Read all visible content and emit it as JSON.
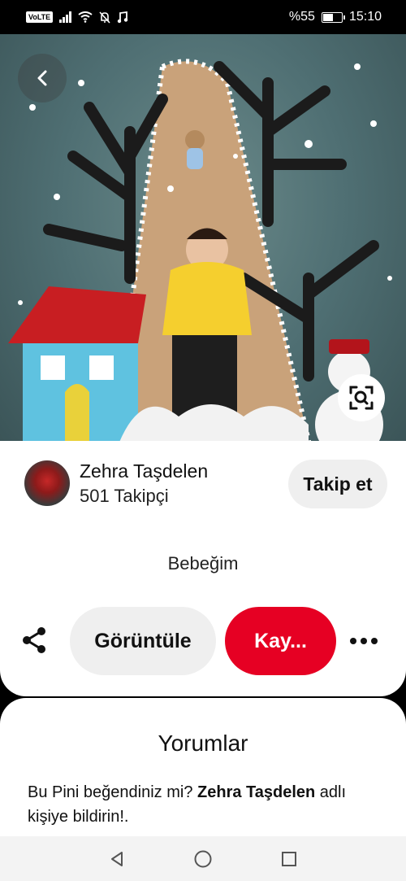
{
  "status_bar": {
    "volte": "VoLTE",
    "battery": "%55",
    "time": "15:10",
    "battery_level": 0.55
  },
  "pin": {
    "title": "Bebeğim",
    "author_name": "Zehra Taşdelen",
    "followers": "501 Takipçi",
    "follow_label": "Takip et",
    "view_label": "Görüntüle",
    "save_label": "Kay..."
  },
  "comments": {
    "title": "Yorumlar",
    "prompt_prefix": "Bu Pini beğendiniz mi? ",
    "prompt_name": "Zehra Taşdelen",
    "prompt_suffix": " adlı kişiye bildirin!."
  },
  "icons": {
    "back": "chevron-left-icon",
    "lens": "visual-search-icon",
    "share": "share-icon",
    "more": "more-dots-icon",
    "nav_back": "triangle-back-icon",
    "nav_home": "circle-home-icon",
    "nav_recents": "square-recents-icon"
  },
  "colors": {
    "accent": "#e60023",
    "button_gray": "#efefef"
  }
}
